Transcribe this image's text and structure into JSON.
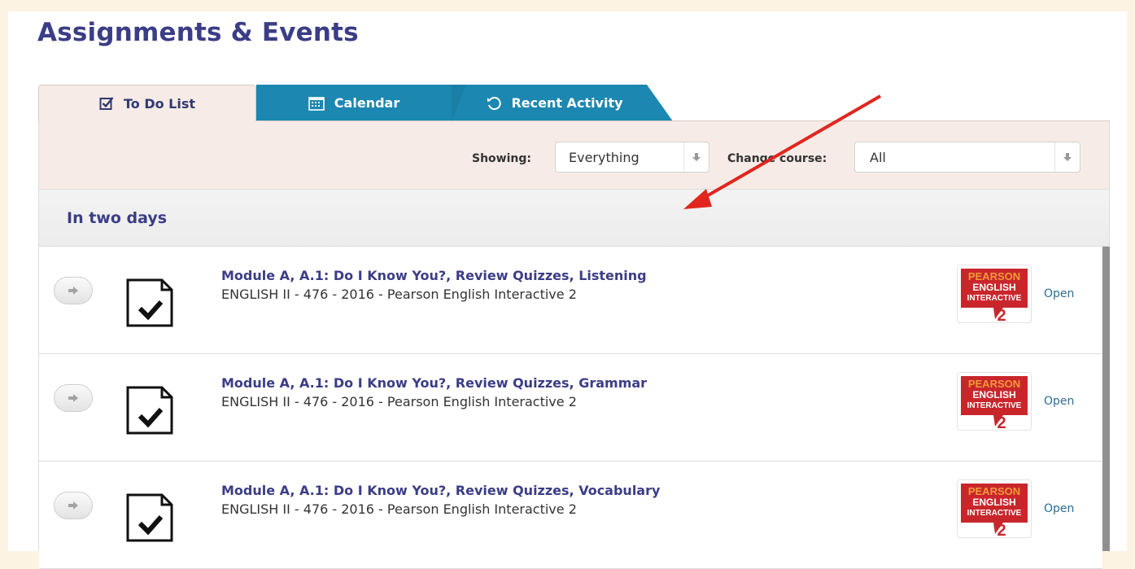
{
  "page": {
    "title": "Assignments & Events"
  },
  "tabs": [
    {
      "label": "To Do List",
      "icon": "checkbox-icon",
      "active": true
    },
    {
      "label": "Calendar",
      "icon": "calendar-icon",
      "active": false
    },
    {
      "label": "Recent Activity",
      "icon": "history-icon",
      "active": false
    }
  ],
  "filters": {
    "showing_label": "Showing:",
    "showing_value": "Everything",
    "course_label": "Change course:",
    "course_value": "All"
  },
  "group": {
    "title": "In two days"
  },
  "items": [
    {
      "title": "Module A, A.1: Do I Know You?, Review Quizzes, Listening",
      "subtitle": "ENGLISH II - 476 - 2016 - Pearson English Interactive 2",
      "action": "Open"
    },
    {
      "title": "Module A, A.1: Do I Know You?, Review Quizzes, Grammar",
      "subtitle": "ENGLISH II - 476 - 2016 - Pearson English Interactive 2",
      "action": "Open"
    },
    {
      "title": "Module A, A.1: Do I Know You?, Review Quizzes, Vocabulary",
      "subtitle": "ENGLISH II - 476 - 2016 - Pearson English Interactive 2",
      "action": "Open"
    }
  ],
  "badge": {
    "line1": "PEARSON",
    "line2": "ENGLISH",
    "line3": "INTERACTIVE",
    "number": "2"
  },
  "colors": {
    "accent": "#3b3d86",
    "tab_blue": "#1c87b0",
    "annotation": "#e0261f",
    "badge_red": "#c9262c"
  }
}
